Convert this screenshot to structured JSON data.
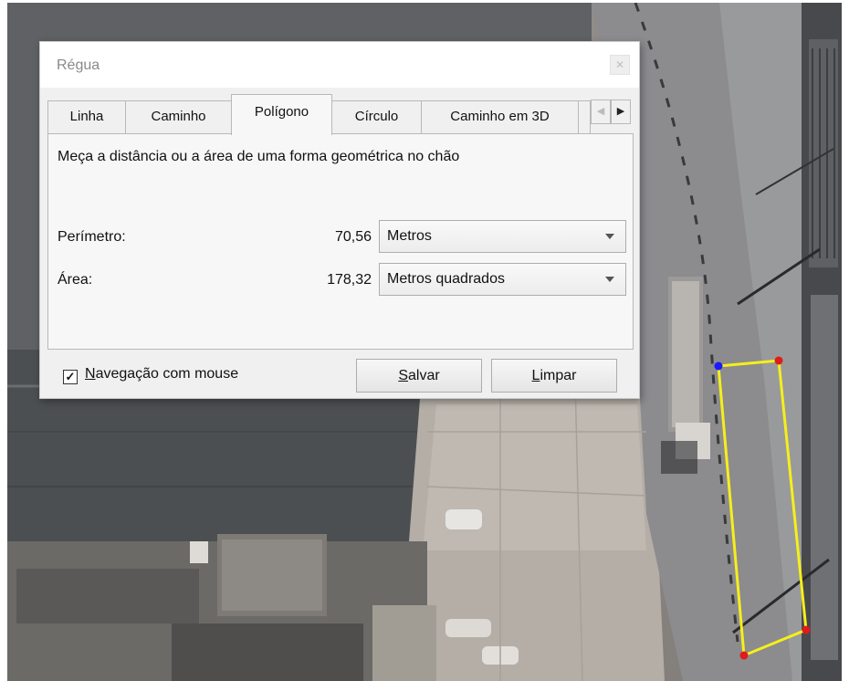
{
  "dialog": {
    "title": "Régua",
    "close_glyph": "✕",
    "tabs": [
      "Linha",
      "Caminho",
      "Polígono",
      "Círculo",
      "Caminho em 3D"
    ],
    "active_tab": "Polígono",
    "tab_scroll_left": "◀",
    "tab_scroll_right": "▶",
    "description": "Meça a distância ou a área de uma forma geométrica no chão",
    "perimeter": {
      "label": "Perímetro:",
      "value": "70,56",
      "unit": "Metros"
    },
    "area": {
      "label": "Área:",
      "value": "178,32",
      "unit": "Metros quadrados"
    },
    "mouse_nav": {
      "checked": true,
      "check_glyph": "✓",
      "label_first": "N",
      "label_rest": "avegação com mouse"
    },
    "save_button": {
      "first": "S",
      "rest": "alvar"
    },
    "clear_button": {
      "first": "L",
      "rest": "impar"
    }
  },
  "polygon": {
    "line_color": "#f5ef1b",
    "start_vertex_color": "#1a1aff",
    "vertex_color": "#e01b1b"
  }
}
